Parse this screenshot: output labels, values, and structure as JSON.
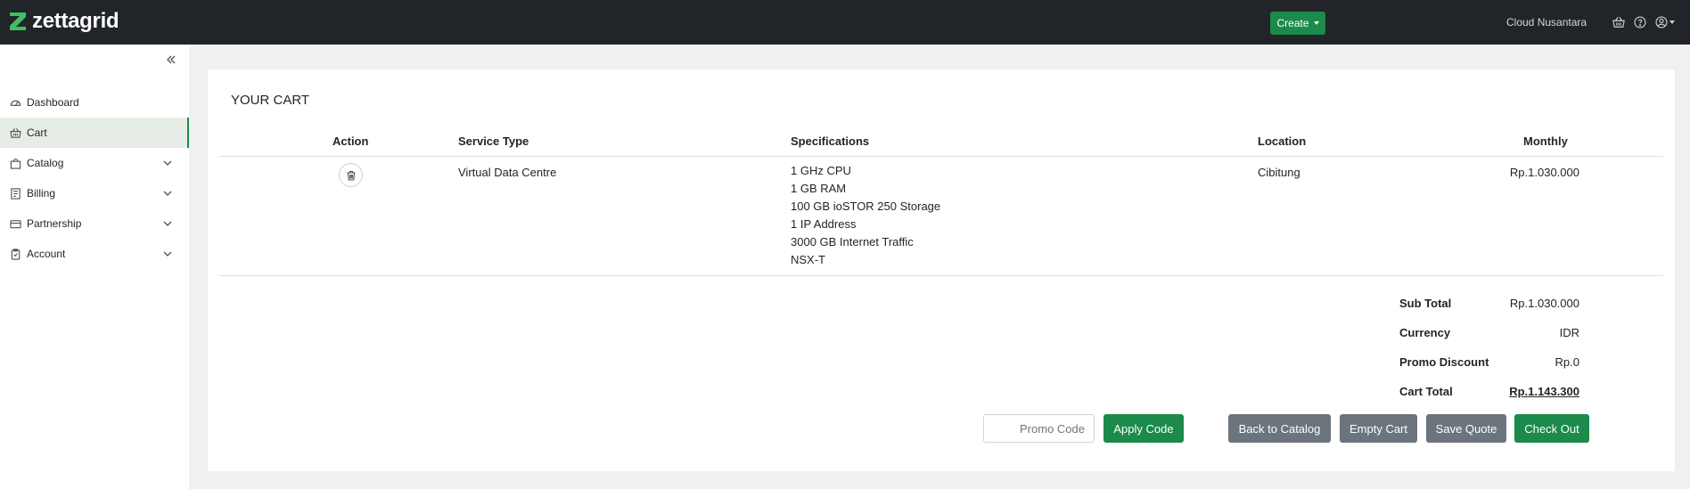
{
  "header": {
    "logo_text": "zettagrid",
    "create_label": "Create",
    "org_name": "Cloud Nusantara",
    "brand_color": "#1b8a4a"
  },
  "sidebar": {
    "items": [
      {
        "label": "Dashboard",
        "icon": "dashboard-icon"
      },
      {
        "label": "Cart",
        "icon": "basket-icon",
        "active": true
      },
      {
        "label": "Catalog",
        "icon": "bag-icon",
        "expandable": true
      },
      {
        "label": "Billing",
        "icon": "receipt-icon",
        "expandable": true
      },
      {
        "label": "Partnership",
        "icon": "card-icon",
        "expandable": true
      },
      {
        "label": "Account",
        "icon": "clipboard-icon",
        "expandable": true
      }
    ]
  },
  "cart": {
    "title": "YOUR CART",
    "columns": {
      "action": "Action",
      "service_type": "Service Type",
      "specifications": "Specifications",
      "location": "Location",
      "monthly": "Monthly"
    },
    "items": [
      {
        "service_type": "Virtual Data Centre",
        "specifications": [
          "1 GHz CPU",
          "1 GB RAM",
          "100 GB ioSTOR 250 Storage",
          "1 IP Address",
          "3000 GB Internet Traffic",
          "NSX-T"
        ],
        "location": "Cibitung",
        "monthly": "Rp.1.030.000"
      }
    ],
    "summary": {
      "sub_total_label": "Sub Total",
      "sub_total": "Rp.1.030.000",
      "currency_label": "Currency",
      "currency": "IDR",
      "promo_discount_label": "Promo Discount",
      "promo_discount": "Rp.0",
      "cart_total_label": "Cart Total",
      "cart_total": "Rp.1.143.300"
    },
    "promo_placeholder": "Promo Code",
    "buttons": {
      "apply_code": "Apply Code",
      "back_to_catalog": "Back to Catalog",
      "empty_cart": "Empty Cart",
      "save_quote": "Save Quote",
      "check_out": "Check Out"
    }
  }
}
